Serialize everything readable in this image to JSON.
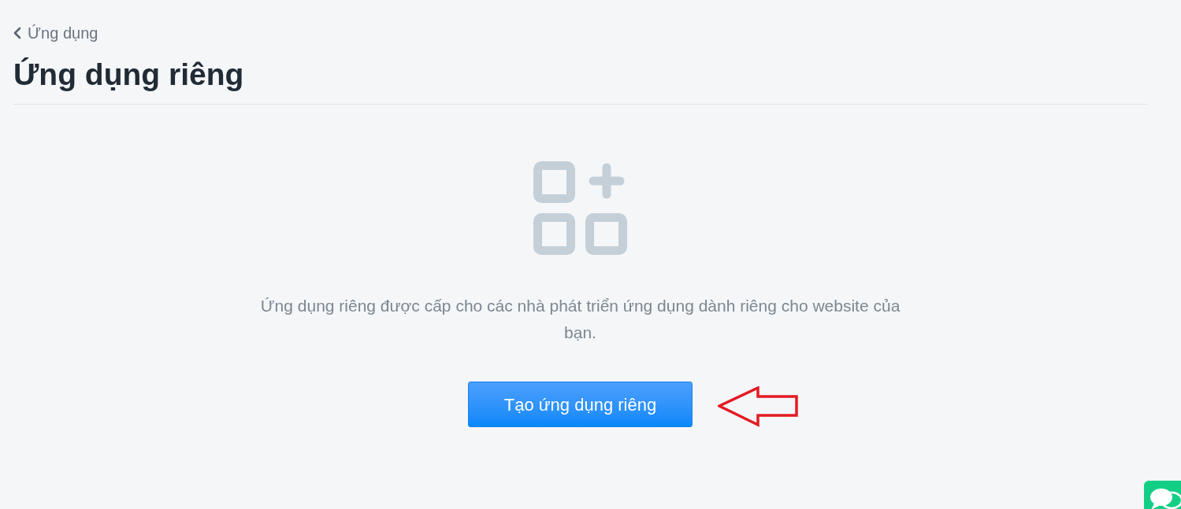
{
  "back_link": {
    "label": "Ứng dụng"
  },
  "page_title": "Ứng dụng riêng",
  "empty_state": {
    "description": "Ứng dụng riêng được cấp cho các nhà phát triển ứng dụng dành riêng cho website của bạn.",
    "button": {
      "label": "Tạo ứng dụng riêng"
    }
  }
}
